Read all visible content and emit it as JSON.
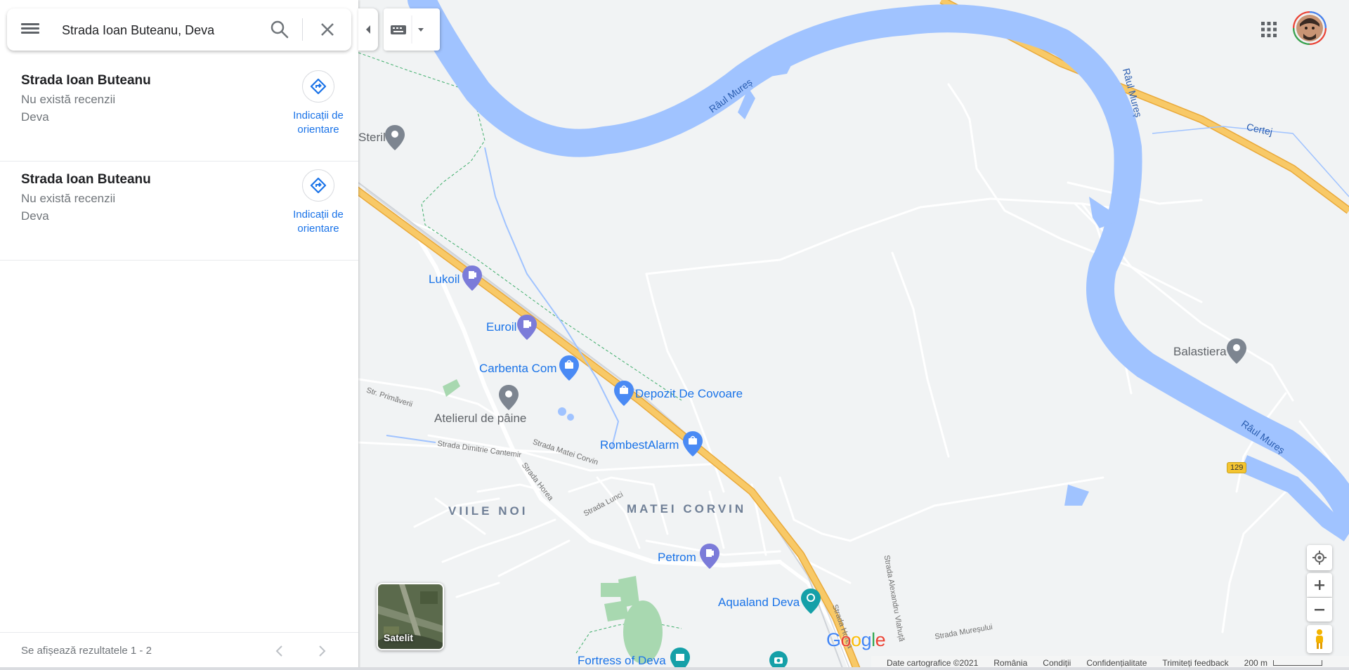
{
  "search": {
    "query": "Strada Ioan Buteanu, Deva"
  },
  "results": [
    {
      "title": "Strada Ioan Buteanu",
      "subtitle": "Nu există recenzii",
      "city": "Deva",
      "directions_label": "Indicații de orientare"
    },
    {
      "title": "Strada Ioan Buteanu",
      "subtitle": "Nu există recenzii",
      "city": "Deva",
      "directions_label": "Indicații de orientare"
    }
  ],
  "footer": {
    "results_text": "Se afișează rezultatele 1 - 2"
  },
  "map": {
    "pois": {
      "steril": "Steril",
      "lukoil": "Lukoil",
      "euroil": "Euroil",
      "carbenta": "Carbenta Com",
      "atelierul": "Atelierul de pâine",
      "depozit": "Depozit De Covoare",
      "rombest": "RombestAlarm",
      "petrom": "Petrom",
      "aqualand": "Aqualand Deva",
      "fortress": "Fortress of Deva",
      "balastiera": "Balastiera"
    },
    "neighborhoods": {
      "viile_noi": "VIILE NOI",
      "matei_corvin": "MATEI CORVIN"
    },
    "streets": {
      "primaverii": "Str. Primăverii",
      "cantemir": "Strada Dimitrie Cantemir",
      "matei_corvin": "Strada Matei Corvin",
      "horea": "Strada Horea",
      "luncii": "Strada Lunci",
      "horea2": "Strada Horea",
      "vlahuta": "Strada Alexandru Vlahuță",
      "muresului": "Strada Mureșului"
    },
    "rivers": {
      "mures1": "Râul Mureș",
      "mures2": "Râul Mureș",
      "mures3": "Râul Mureș",
      "certej": "Certej"
    },
    "road_shield": "129",
    "satellite_label": "Satelit",
    "google_logo": {
      "letters": [
        "G",
        "o",
        "o",
        "g",
        "l",
        "e"
      ],
      "colors": [
        "#4285F4",
        "#EA4335",
        "#FBBC05",
        "#4285F4",
        "#34A853",
        "#EA4335"
      ]
    }
  },
  "attribution": {
    "data": "Date cartografice ©2021",
    "country": "România",
    "terms": "Condiții",
    "privacy": "Confidențialitate",
    "feedback": "Trimiteți feedback",
    "scale": "200 m"
  },
  "colors": {
    "accent": "#1a73e8",
    "water": "#a0c3ff",
    "highway": "#f8c967",
    "highway_stroke": "#e9a93a",
    "poi_purple": "#7b7bd9",
    "poi_gray": "#7d8590"
  }
}
